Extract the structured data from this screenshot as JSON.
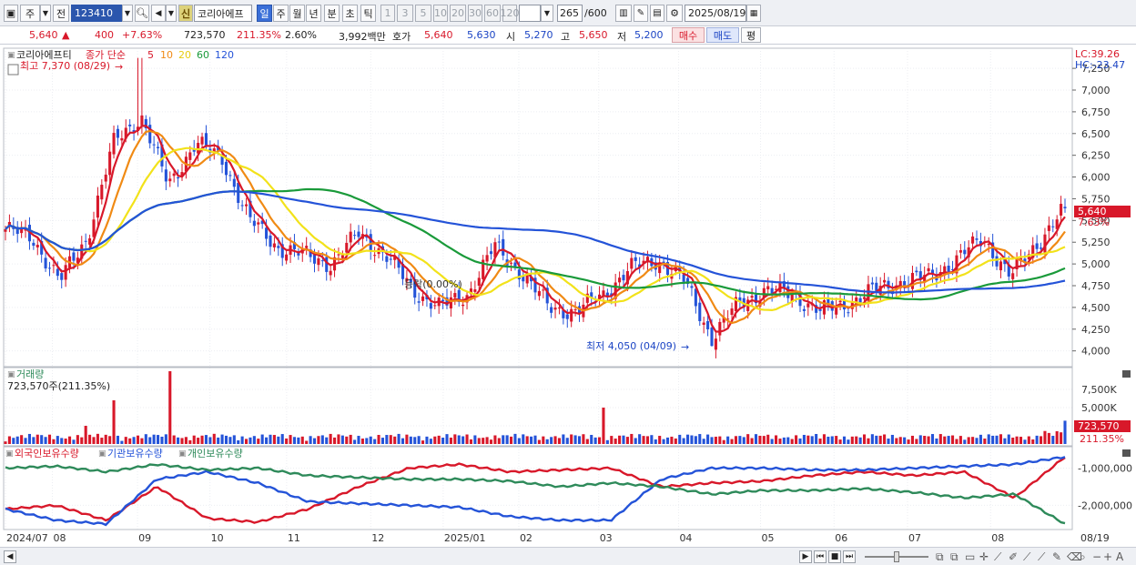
{
  "toolbar": {
    "market": "주",
    "market_type": "전",
    "code": "123410",
    "badge": "신",
    "stock_name": "코리아에프",
    "periods": [
      "일",
      "주",
      "월",
      "년",
      "분",
      "초",
      "틱"
    ],
    "active_period": "일",
    "intervals": [
      "1",
      "3",
      "5",
      "10",
      "20",
      "30",
      "60",
      "120"
    ],
    "count": "265",
    "count_max": "/600",
    "date": "2025/08/19"
  },
  "quote": {
    "price": "5,640",
    "arrow": "▲",
    "change": "400",
    "change_pct": "+7.63%",
    "volume": "723,570",
    "volume_ratio": "211.35%",
    "turnover": "2.60%",
    "amount": "3,992백만",
    "hoga_label": "호가",
    "ask": "5,640",
    "bid": "5,630",
    "open_label": "시",
    "open": "5,270",
    "high_label": "고",
    "high": "5,650",
    "low_label": "저",
    "low": "5,200",
    "buy_label": "매수",
    "sell_label": "매도",
    "avg_label": "평"
  },
  "price_panel": {
    "legend_name": "코리아에프티",
    "legend_type": "종가 단순",
    "ma_periods": [
      "5",
      "10",
      "20",
      "60",
      "120"
    ],
    "ma_colors": [
      "#d8182a",
      "#f08a14",
      "#f2e21a",
      "#1a9a3a",
      "#2453d8"
    ],
    "lc_label": "LC:39.26",
    "hc_label": "HC:-23.47",
    "high_note": "최고 7,370 (08/29)",
    "low_note": "최저 4,050 (04/09)",
    "mid_note": "등락(0.00%)",
    "last_price": "5,640",
    "last_pct": "7.63%",
    "y_ticks": [
      "7,250",
      "7,000",
      "6,750",
      "6,500",
      "6,250",
      "6,000",
      "5,750",
      "5,500",
      "5,250",
      "5,000",
      "4,750",
      "4,500",
      "4,250",
      "4,000"
    ]
  },
  "volume_panel": {
    "title": "거래량",
    "value": "723,570주(211.35%)",
    "y_ticks": [
      "7,500K",
      "5,000K",
      "2,500K"
    ],
    "last_value": "723,570",
    "last_pct": "211.35%"
  },
  "holdings_panel": {
    "series": [
      {
        "name": "외국인보유수량",
        "color": "#d8182a"
      },
      {
        "name": "기관보유수량",
        "color": "#2453d8"
      },
      {
        "name": "개인보유수량",
        "color": "#2e8a5a"
      }
    ],
    "y_ticks": [
      "-1,000,000",
      "-2,000,000"
    ]
  },
  "x_axis": [
    "2024/07",
    "08",
    "09",
    "10",
    "11",
    "12",
    "2025/01",
    "02",
    "03",
    "04",
    "05",
    "06",
    "07",
    "08",
    "08/19"
  ],
  "chart_data": [
    {
      "type": "candlestick",
      "title": "코리아에프티",
      "ylim": [
        3850,
        7450
      ],
      "x_ticks": [
        "2024/07",
        "08",
        "09",
        "10",
        "11",
        "12",
        "2025/01",
        "02",
        "03",
        "04",
        "05",
        "06",
        "07",
        "08"
      ],
      "close_points": [
        {
          "x": "2024/07",
          "y": 5400
        },
        {
          "x": "07 mid",
          "y": 5300
        },
        {
          "x": "08 early",
          "y": 4800
        },
        {
          "x": "08 mid",
          "y": 5300
        },
        {
          "x": "08 late",
          "y": 6400
        },
        {
          "x": "08/29",
          "y": 6700
        },
        {
          "x": "09 mid",
          "y": 5900
        },
        {
          "x": "09 late",
          "y": 6400
        },
        {
          "x": "10",
          "y": 6200
        },
        {
          "x": "10 mid",
          "y": 5500
        },
        {
          "x": "10 late",
          "y": 5200
        },
        {
          "x": "11",
          "y": 5100
        },
        {
          "x": "11 mid",
          "y": 5000
        },
        {
          "x": "11 late",
          "y": 5350
        },
        {
          "x": "12",
          "y": 5100
        },
        {
          "x": "12 mid",
          "y": 4700
        },
        {
          "x": "12 late",
          "y": 4500
        },
        {
          "x": "2025/01",
          "y": 4650
        },
        {
          "x": "01 mid",
          "y": 5200
        },
        {
          "x": "02",
          "y": 4900
        },
        {
          "x": "02 mid",
          "y": 4500
        },
        {
          "x": "02 late",
          "y": 4450
        },
        {
          "x": "03",
          "y": 4650
        },
        {
          "x": "03 mid",
          "y": 4950
        },
        {
          "x": "03 late",
          "y": 5050
        },
        {
          "x": "04",
          "y": 4800
        },
        {
          "x": "04/09",
          "y": 4150
        },
        {
          "x": "04 late",
          "y": 4550
        },
        {
          "x": "05",
          "y": 4700
        },
        {
          "x": "05 mid",
          "y": 4650
        },
        {
          "x": "05 late",
          "y": 4450
        },
        {
          "x": "06",
          "y": 4550
        },
        {
          "x": "06 mid",
          "y": 4700
        },
        {
          "x": "06 late",
          "y": 4800
        },
        {
          "x": "07",
          "y": 4850
        },
        {
          "x": "07 mid",
          "y": 5050
        },
        {
          "x": "07 late",
          "y": 5300
        },
        {
          "x": "08",
          "y": 4850
        },
        {
          "x": "08 mid",
          "y": 5250
        },
        {
          "x": "08/19",
          "y": 5640
        }
      ],
      "high": {
        "label": "최고",
        "value": 7370,
        "date": "08/29"
      },
      "low": {
        "label": "최저",
        "value": 4050,
        "date": "04/09"
      },
      "last": 5640
    },
    {
      "type": "bar",
      "title": "거래량",
      "ylim": [
        0,
        10000
      ],
      "unit": "K",
      "spikes": [
        {
          "x": "08 mid",
          "value": 5500
        },
        {
          "x": "08 late",
          "value": 6000
        },
        {
          "x": "09 mid",
          "value": 10000
        },
        {
          "x": "03",
          "value": 5000
        },
        {
          "x": "08 mid",
          "value": 2500
        },
        {
          "x": "08/19",
          "value": 3200
        }
      ],
      "last": 723570
    },
    {
      "type": "line",
      "ylim": [
        -2600000,
        -500000
      ],
      "series": [
        {
          "name": "외국인보유수량",
          "values": [
            -2100000,
            -2000000,
            -2400000,
            -1500000,
            -2350000,
            -2450000,
            -2100000,
            -1500000,
            -1000000,
            -900000,
            -1100000,
            -1050000,
            -1000000,
            -1500000,
            -1400000,
            -1350000,
            -1200000,
            -1100000,
            -1200000,
            -1100000,
            -1800000,
            -700000
          ]
        },
        {
          "name": "기관보유수량",
          "values": [
            -2100000,
            -2400000,
            -2500000,
            -1300000,
            -1100000,
            -1400000,
            -1900000,
            -1950000,
            -2000000,
            -2050000,
            -2300000,
            -2400000,
            -2400000,
            -1300000,
            -1000000,
            -1000000,
            -1050000,
            -1050000,
            -1000000,
            -950000,
            -900000,
            -700000
          ]
        },
        {
          "name": "개인보유수량",
          "values": [
            -1000000,
            -950000,
            -1100000,
            -900000,
            -1050000,
            -1000000,
            -1200000,
            -1250000,
            -1300000,
            -1300000,
            -1350000,
            -1500000,
            -1400000,
            -1500000,
            -1700000,
            -1600000,
            -1600000,
            -1550000,
            -1650000,
            -1800000,
            -1700000,
            -2500000
          ]
        }
      ]
    }
  ]
}
